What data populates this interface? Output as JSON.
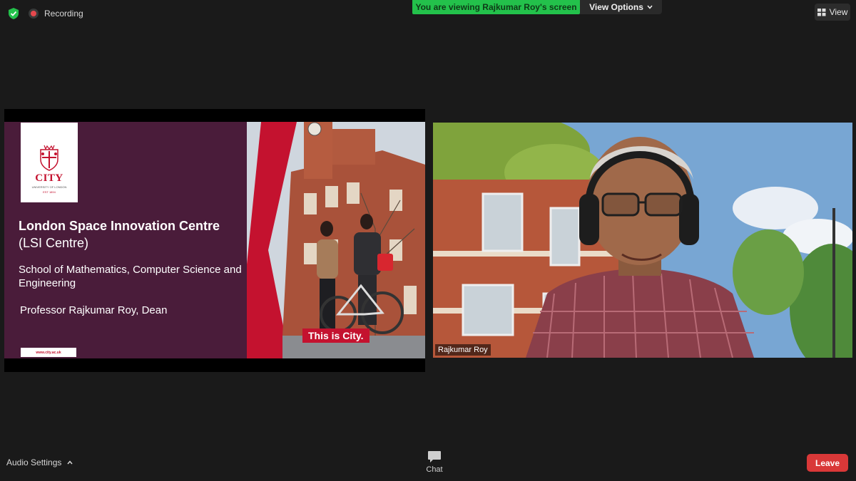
{
  "top_bar": {
    "recording_label": "Recording",
    "viewing_banner": "You are viewing Rajkumar Roy's screen",
    "view_options_label": "View Options",
    "view_button_label": "View"
  },
  "shared_slide": {
    "logo_text": "CITY",
    "logo_subtext": "UNIVERSITY OF LONDON",
    "logo_est": "EST 1894",
    "title": "London Space Innovation Centre",
    "abbreviation": "(LSI Centre)",
    "school": "School of Mathematics, Computer Science and Engineering",
    "presenter": "Professor Rajkumar Roy, Dean",
    "url": "www.city.ac.uk",
    "tagline": "This is City."
  },
  "video": {
    "participant_name": "Rajkumar Roy"
  },
  "bottom_bar": {
    "audio_settings_label": "Audio Settings",
    "chat_label": "Chat",
    "leave_label": "Leave"
  },
  "colors": {
    "background": "#1a1a1a",
    "banner_green": "#23c14b",
    "leave_red": "#d93838",
    "slide_maroon": "#4a1c3a",
    "city_red": "#c4122f"
  },
  "icons": [
    "shield-icon",
    "record-icon",
    "chevron-down-icon",
    "grid-view-icon",
    "chevron-up-icon",
    "chat-bubble-icon"
  ]
}
